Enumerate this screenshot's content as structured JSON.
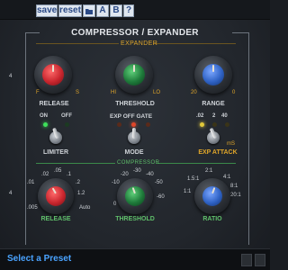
{
  "toolbar": {
    "save_label": "save",
    "reset_label": "reset",
    "open_icon": "folder-icon",
    "a_label": "A",
    "b_label": "B",
    "help_label": "?"
  },
  "panel": {
    "title": "COMPRESSOR / EXPANDER",
    "expander_section": "EXPANDER",
    "compressor_section": "COMPRESSOR",
    "left_edge_value": "4"
  },
  "expander": {
    "release": {
      "label": "RELEASE",
      "min": "F",
      "max": "S",
      "color": "#c9262e"
    },
    "threshold": {
      "label": "THRESHOLD",
      "min": "HI",
      "max": "LO",
      "color": "#1e7a3a"
    },
    "range": {
      "label": "RANGE",
      "min": "20",
      "max": "0",
      "color": "#2f62c4"
    }
  },
  "limiter": {
    "label": "LIMITER",
    "on": "ON",
    "off": "OFF"
  },
  "mode": {
    "label": "MODE",
    "options": "EXP OFF GATE"
  },
  "exp_attack": {
    "label": "EXP ATTACK",
    "v1": ".02",
    "v2": "2",
    "v3": "40",
    "unit": "mS"
  },
  "compressor": {
    "release": {
      "label": "RELEASE",
      "scale": [
        ".01",
        ".02",
        ".05",
        ".1",
        ".2",
        "1.2",
        "Auto",
        ".005"
      ],
      "color": "#c9262e"
    },
    "threshold": {
      "label": "THRESHOLD",
      "scale": [
        "-10",
        "-20",
        "-30",
        "-40",
        "-50",
        "-60",
        "0"
      ],
      "color": "#1e7a3a"
    },
    "ratio": {
      "label": "RATIO",
      "scale": [
        "1:1",
        "1.5:1",
        "2:1",
        "4:1",
        "8:1",
        "20:1"
      ],
      "color": "#2f62c4"
    }
  },
  "footer": {
    "preset": "Select a Preset"
  }
}
